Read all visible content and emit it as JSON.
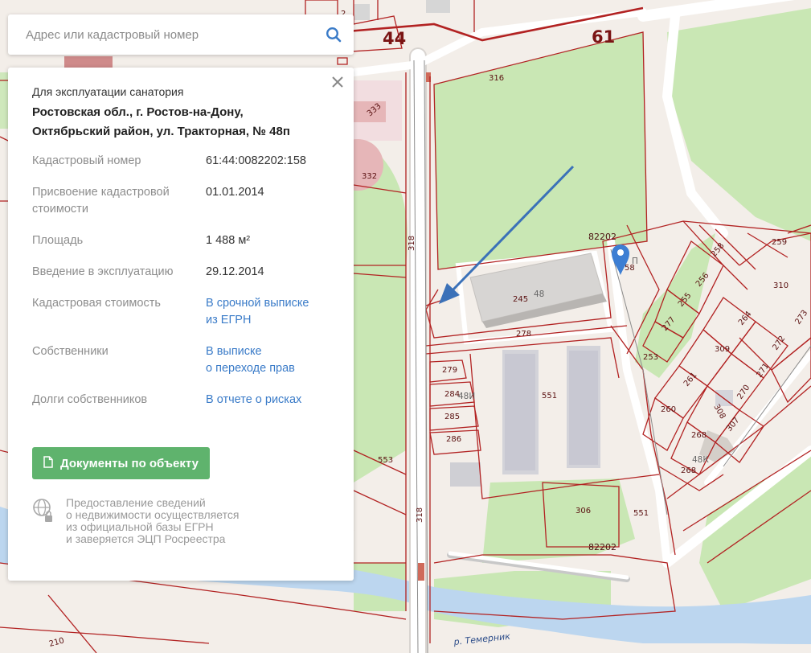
{
  "search": {
    "placeholder": "Адрес или кадастровый номер"
  },
  "panel": {
    "purpose": "Для эксплуатации санатория",
    "address_line1": "Ростовская обл., г. Ростов-на-Дону,",
    "address_line2": "Октябрьский район, ул. Тракторная, № 48п",
    "fields": [
      {
        "label": "Кадастровый номер",
        "value": "61:44:0082202:158"
      },
      {
        "label_line1": "Присвоение кадастровой",
        "label_line2": "стоимости",
        "value": "01.01.2014"
      },
      {
        "label": "Площадь",
        "value": "1 488 м²"
      },
      {
        "label": "Введение в эксплуатацию",
        "value": "29.12.2014"
      },
      {
        "label": "Кадастровая стоимость",
        "link_line1": "В срочной выписке",
        "link_line2": "из ЕГРН"
      },
      {
        "label": "Собственники",
        "link_line1": "В выписке",
        "link_line2": "о переходе прав"
      },
      {
        "label": "Долги собственников",
        "link_line1": "В отчете о рисках"
      }
    ],
    "docs_button": "Документы по объекту",
    "note_lines": [
      "Предоставление сведений",
      "о недвижимости осуществляется",
      "из официальной базы ЕГРН",
      "и заверяется ЭЦП Росреестра"
    ]
  },
  "map": {
    "plots": {
      "n44": "44",
      "n61": "61",
      "n316": "316",
      "n333": "333",
      "n332": "332",
      "n318a": "318",
      "n318b": "318",
      "n553": "553",
      "n82202a": "82202",
      "n82202b": "82202",
      "n245": "245",
      "n278": "278",
      "n279": "279",
      "n284": "284",
      "n285": "285",
      "n286": "286",
      "n551a": "551",
      "n551b": "551",
      "n306": "306",
      "n253": "253",
      "n258": "258",
      "n259": "259",
      "n256": "256",
      "n255": "255",
      "n277": "277",
      "n310": "310",
      "n264": "264",
      "n273": "273",
      "n309": "309",
      "n272": "272",
      "n261": "261",
      "n271": "271",
      "n260": "260",
      "n270": "270",
      "n308": "308",
      "n307": "307",
      "n268a": "268",
      "n268b": "268",
      "n210": "210",
      "n158": "58",
      "n2": "2"
    },
    "buildings": {
      "b48": "48",
      "b48i": "48И",
      "b48k": "48К",
      "bP": "П"
    },
    "river": "р. Темерник",
    "colors": {
      "boundary": "#b22222",
      "green": "#c9e7b4",
      "water": "#bcd6ef",
      "arrow": "#3b71b8",
      "marker": "#3d7ed3"
    }
  }
}
